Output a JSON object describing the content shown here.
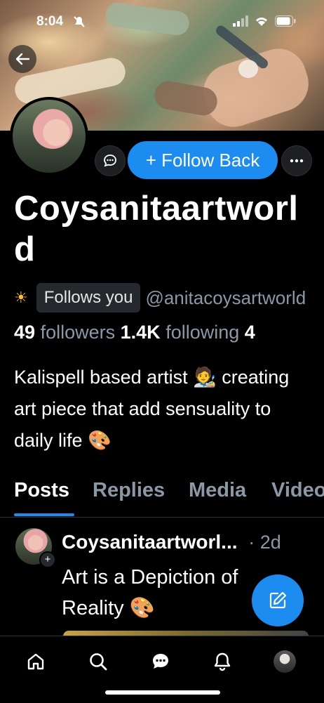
{
  "status_bar": {
    "time": "8:04"
  },
  "profile": {
    "display_name": "Coysanitaartworld",
    "follows_you_badge": "Follows you",
    "handle": "@anitacoysartworld",
    "followers_count": "49",
    "followers_label": "followers",
    "following_count": "1.4K",
    "following_label": "following",
    "extra_count": "4",
    "bio": "Kalispell based artist 🧑‍🎨 creating art piece that add sensuality to daily life 🎨"
  },
  "actions": {
    "follow_back": "+ Follow Back"
  },
  "tabs": [
    "Posts",
    "Replies",
    "Media",
    "Videos"
  ],
  "post": {
    "author": "Coysanitaartworl...",
    "time": "· 2d",
    "text": "Art is a Depiction of Reality 🎨"
  },
  "colors": {
    "accent": "#1d8cf0",
    "muted": "#8b98a5",
    "background": "#000000"
  }
}
